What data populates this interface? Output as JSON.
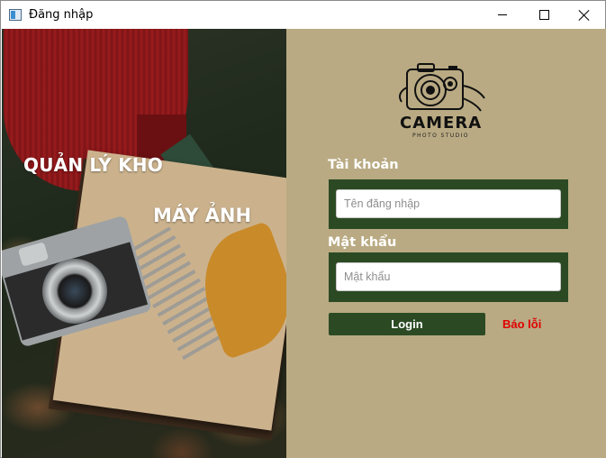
{
  "window": {
    "title": "Đăng nhập",
    "icon": "app-window-icon",
    "controls": {
      "minimize": "minimize-icon",
      "maximize": "maximize-icon",
      "close": "close-icon"
    }
  },
  "banner": {
    "line1": "QUẢN LÝ KHO",
    "line2": "MÁY ẢNH"
  },
  "logo": {
    "icon": "camera-logo-icon",
    "brand": "CAMERA",
    "tagline": "PHOTO STUDIO"
  },
  "form": {
    "username_label": "Tài khoản",
    "username_value": "",
    "username_placeholder": "Tên đăng nhập",
    "password_label": "Mật khẩu",
    "password_value": "",
    "password_placeholder": "Mật khẩu",
    "login_label": "Login",
    "report_label": "Báo lỗi"
  },
  "colors": {
    "panel_bg": "#b9aa83",
    "accent_green": "#2b4a24",
    "error_red": "#e00000",
    "text_white": "#ffffff"
  }
}
